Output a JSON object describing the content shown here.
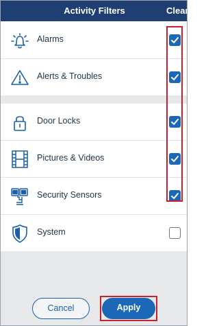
{
  "header": {
    "title": "Activity Filters",
    "clear_label": "Clear"
  },
  "filters": [
    {
      "label": "Alarms",
      "icon": "alarm-bell-icon",
      "checked": true
    },
    {
      "label": "Alerts & Troubles",
      "icon": "warning-triangle-icon",
      "checked": true
    },
    {
      "label": "Door Locks",
      "icon": "padlock-icon",
      "checked": true
    },
    {
      "label": "Pictures & Videos",
      "icon": "film-strip-icon",
      "checked": true
    },
    {
      "label": "Security Sensors",
      "icon": "sensor-icon",
      "checked": true
    },
    {
      "label": "System",
      "icon": "shield-icon",
      "checked": false
    }
  ],
  "footer": {
    "cancel_label": "Cancel",
    "apply_label": "Apply"
  },
  "colors": {
    "header": "#1f3f73",
    "accent": "#1b68b7",
    "highlight": "#c8202d",
    "icon": "#1b5fa8"
  }
}
